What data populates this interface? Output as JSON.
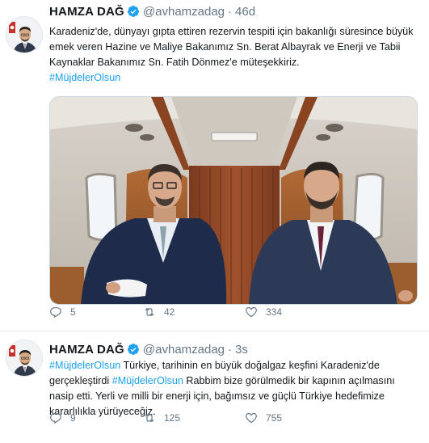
{
  "tweets": [
    {
      "name": "HAMZA DAĞ",
      "handle": "@avhamzadag",
      "dot": "·",
      "time": "46d",
      "text_parts": [
        "Karadeniz'de, dünyayı gıpta ettiren rezervin tespiti için bakanlığı süresince büyük emek veren Hazine ve Maliye Bakanımız Sn. Berat Albayrak ve Enerji ve Tabii Kaynaklar Bakanımız Sn. Fatih Dönmez'e müteşekkiriz."
      ],
      "hashtag": "#MüjdelerOlsun",
      "replies": "5",
      "retweets": "42",
      "likes": "334",
      "icons": {
        "reply": "reply-icon",
        "retweet": "retweet-icon",
        "like": "heart-icon",
        "verified": "verified-badge-icon"
      }
    },
    {
      "name": "HAMZA DAĞ",
      "handle": "@avhamzadag",
      "dot": "·",
      "time": "3s",
      "hashtag_1": "#MüjdelerOlsun",
      "text_1": " Türkiye, tarihinin en büyük doğalgaz keşfini Karadeniz'de gerçekleştirdi ",
      "hashtag_2": "#MüjdelerOlsun",
      "text_2": " Rabbim bize görülmedik bir kapının açılmasını nasip etti. Yerli ve milli bir enerji için, bağımsız ve güçlü Türkiye hedefimize kararlılıkla yürüyeceğiz.",
      "replies": "9",
      "retweets": "125",
      "likes": "755"
    }
  ],
  "colors": {
    "accent": "#1da1f2",
    "muted": "#657786",
    "text": "#14171a",
    "border": "#e6ecf0"
  }
}
